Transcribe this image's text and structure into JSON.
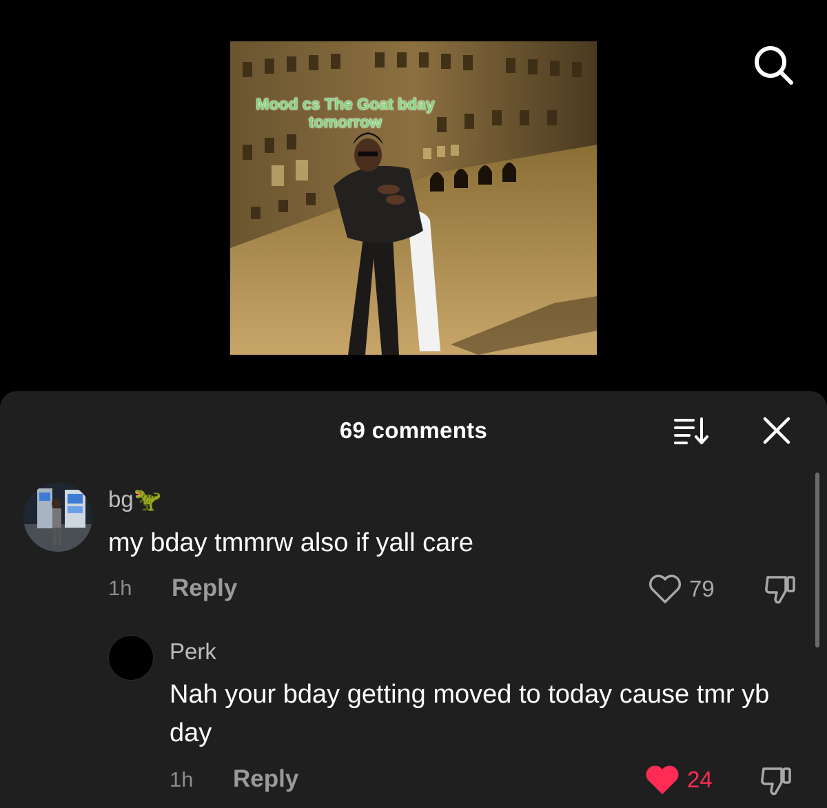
{
  "video": {
    "caption": "Mood cs The Goat bday tomorrow"
  },
  "comments_sheet": {
    "title": "69 comments",
    "comments": [
      {
        "username": "bg🦖",
        "text": "my bday tmmrw also if yall care",
        "time": "1h",
        "reply_label": "Reply",
        "likes": "79",
        "liked": false
      },
      {
        "username": "Perk",
        "text": "Nah your bday getting moved to today cause tmr yb day",
        "time": "1h",
        "reply_label": "Reply",
        "likes": "24",
        "liked": true
      }
    ]
  },
  "colors": {
    "sheet_bg": "#1f1f1f",
    "liked_red": "#fe2c55",
    "caption_green": "#7ed87a"
  },
  "icons": [
    "search-icon",
    "sort-icon",
    "close-icon",
    "heart-icon",
    "heart-filled-icon",
    "dislike-icon"
  ]
}
